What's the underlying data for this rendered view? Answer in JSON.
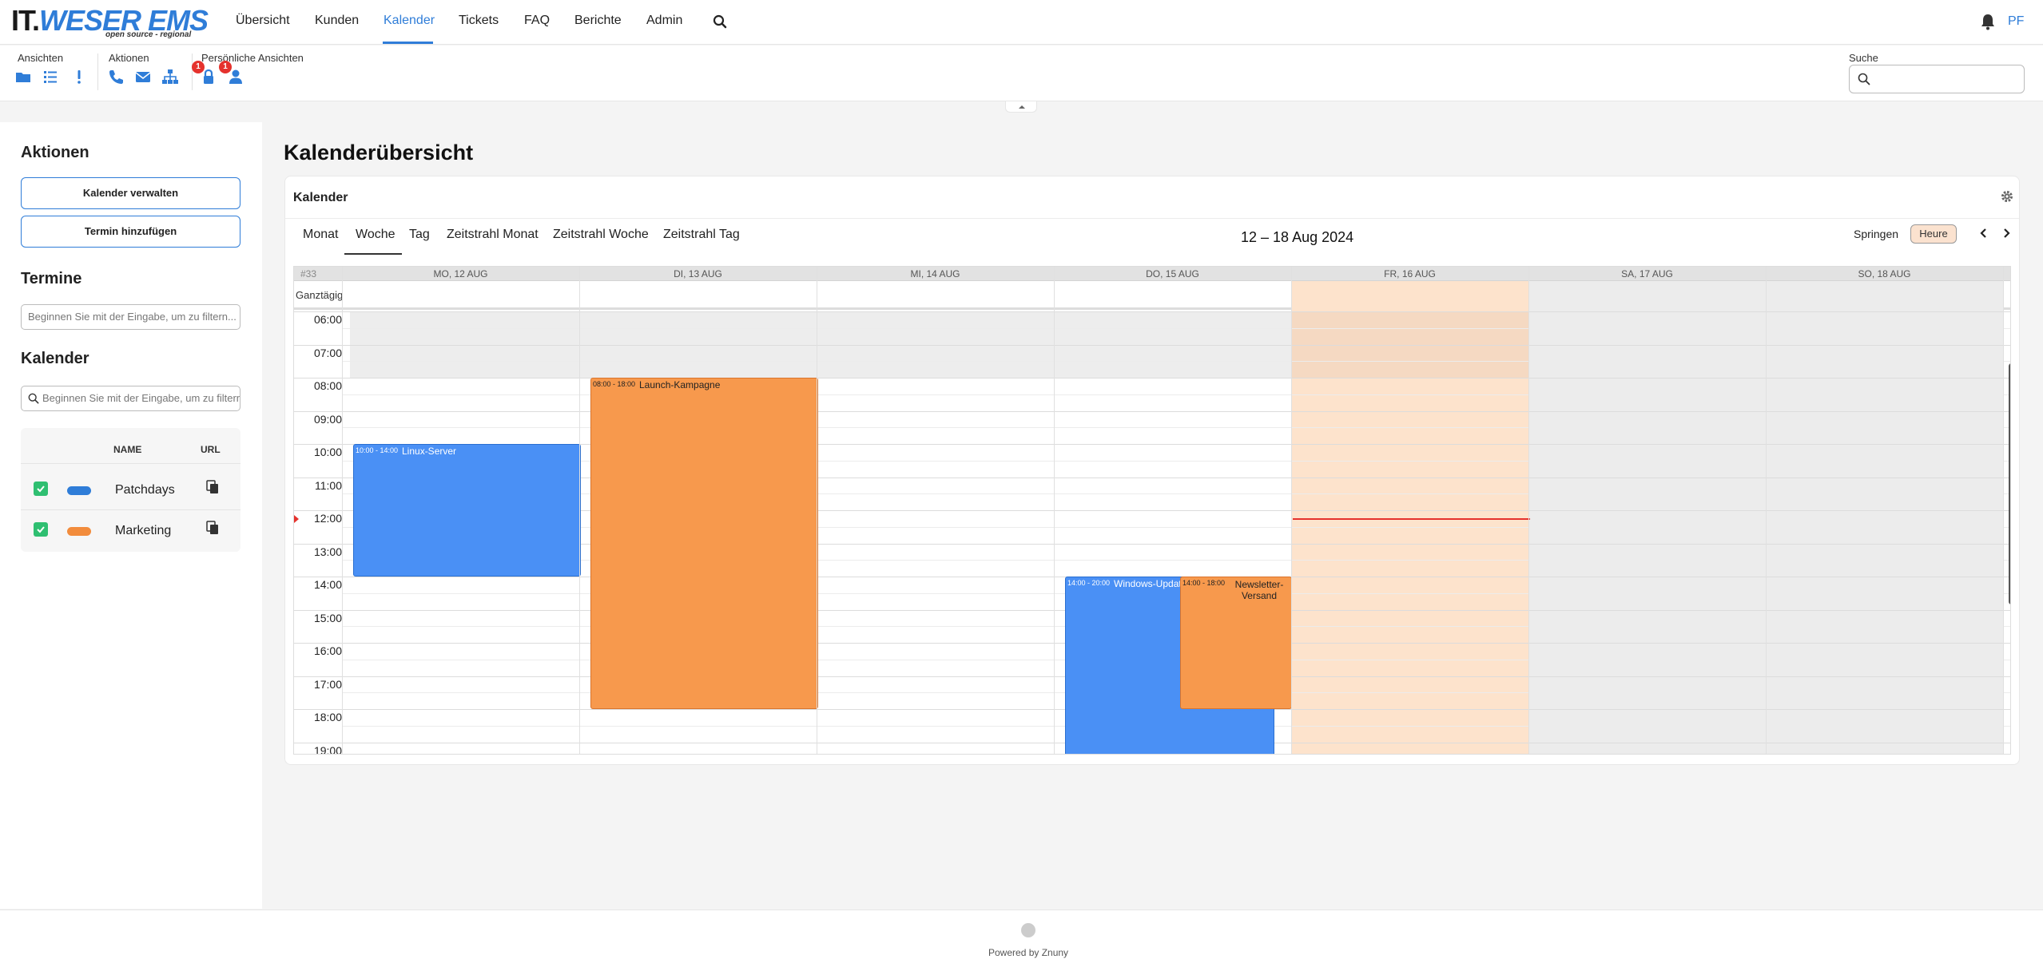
{
  "brand": {
    "prefix": "IT.",
    "name": "WESER EMS",
    "tagline": "open source - regional"
  },
  "nav": {
    "items": [
      "Übersicht",
      "Kunden",
      "Kalender",
      "Tickets",
      "FAQ",
      "Berichte",
      "Admin"
    ],
    "active": "Kalender",
    "user_initials": "PF"
  },
  "toolbar": {
    "ansichten_label": "Ansichten",
    "aktionen_label": "Aktionen",
    "persoenlich_label": "Persönliche Ansichten",
    "lock_badge": "1",
    "user_badge": "1",
    "search_label": "Suche"
  },
  "sidebar": {
    "aktionen_heading": "Aktionen",
    "manage_button": "Kalender verwalten",
    "add_button": "Termin hinzufügen",
    "termine_heading": "Termine",
    "termine_placeholder": "Beginnen Sie mit der Eingabe, um zu filtern...",
    "kalender_heading": "Kalender",
    "kalender_placeholder": "Beginnen Sie mit der Eingabe, um zu filtern...",
    "table_headers": {
      "name": "NAME",
      "url": "URL"
    },
    "calendars": [
      {
        "name": "Patchdays",
        "color": "#2f7dd8"
      },
      {
        "name": "Marketing",
        "color": "#f28c3c"
      }
    ]
  },
  "main": {
    "page_title": "Kalenderübersicht",
    "card_title": "Kalender",
    "views": [
      "Monat",
      "Woche",
      "Tag",
      "Zeitstrahl Monat",
      "Zeitstrahl Woche",
      "Zeitstrahl Tag"
    ],
    "active_view": "Woche",
    "date_range": "12 – 18 Aug 2024",
    "jump_label": "Springen",
    "today_label": "Heure",
    "week_label": "#33",
    "allday_label": "Ganztägig",
    "days": [
      "MO, 12 AUG",
      "DI, 13 AUG",
      "MI, 14 AUG",
      "DO, 15 AUG",
      "FR, 16 AUG",
      "SA, 17 AUG",
      "SO, 18 AUG"
    ],
    "hours": [
      "06:00",
      "07:00",
      "08:00",
      "09:00",
      "10:00",
      "11:00",
      "12:00",
      "13:00",
      "14:00",
      "15:00",
      "16:00",
      "17:00",
      "18:00",
      "19:00"
    ],
    "events": [
      {
        "time": "10:00 - 14:00",
        "title": "Linux-Server"
      },
      {
        "time": "08:00 - 18:00",
        "title": "Launch-Kampagne"
      },
      {
        "time": "14:00 - 20:00",
        "title": "Windows-Updates"
      },
      {
        "time": "14:00 - 18:00",
        "title": "Newsletter-Versand"
      }
    ],
    "colors": {
      "patchdays": "#4a90f5",
      "marketing": "#f7994d",
      "today_col": "#fde3cc",
      "now_line": "#e5322d"
    }
  },
  "footer": {
    "text": "Powered by Znuny"
  }
}
